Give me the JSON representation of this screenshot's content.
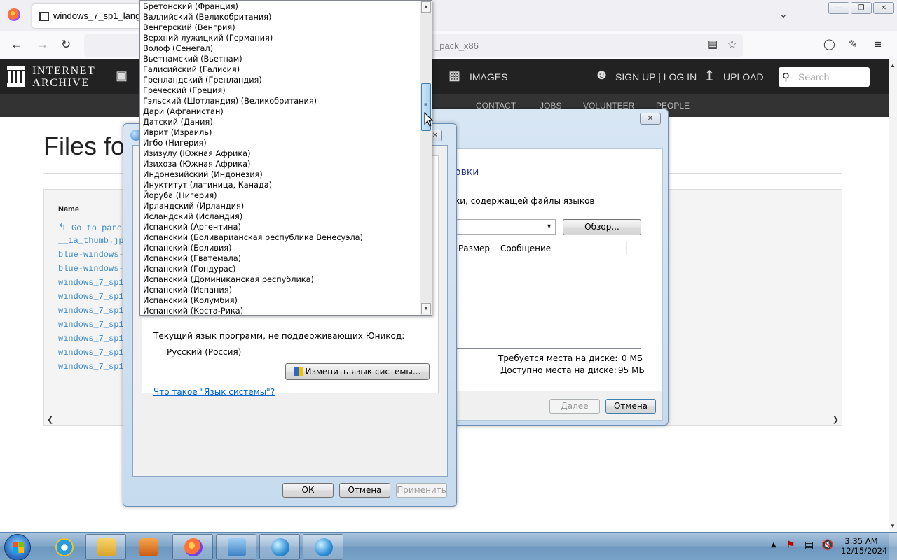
{
  "browser": {
    "tab_title": "windows_7_sp1_langua",
    "url_fragment": "_pack_x86",
    "icons": {
      "back": "back-arrow-icon",
      "forward": "forward-arrow-icon",
      "reload": "reload-icon",
      "reader": "reader-view-icon",
      "bookmark": "bookmark-star-icon",
      "pocket": "pocket-icon",
      "extensions": "extensions-icon",
      "menu": "hamburger-menu-icon"
    }
  },
  "ia": {
    "logo_line1": "INTERNET",
    "logo_line2": "ARCHIVE",
    "images": "IMAGES",
    "signup": "SIGN UP | LOG IN",
    "upload": "UPLOAD",
    "search_placeholder": "Search",
    "sub_nav": [
      "CONTACT",
      "JOBS",
      "VOLUNTEER",
      "PEOPLE"
    ],
    "page_title": "Files fo",
    "files_header": "Name",
    "files": [
      "Go to pare",
      "__ia_thumb.jp",
      "blue-windows-",
      "blue-windows-",
      "windows_7_sp1",
      "windows_7_sp1",
      "windows_7_sp1",
      "windows_7_sp1",
      "windows_7_sp1",
      "windows_7_sp1",
      "windows_7_sp1"
    ]
  },
  "install_dialog": {
    "heading_fragment": "овки",
    "instruction_fragment": "ки, содержащей файлы языков",
    "browse": "Обзор...",
    "col_size": "Размер",
    "col_message": "Сообщение",
    "space_required_label": "Требуется места на диске:",
    "space_required_value": "0 МБ",
    "space_available_label": "Доступно места на диске:",
    "space_available_value": "95 МБ",
    "next": "Далее",
    "cancel": "Отмена"
  },
  "region_dialog": {
    "nonunicode_label": "Текущий язык программ, не поддерживающих Юникод:",
    "current_language": "Русский (Россия)",
    "change_system_locale": "Изменить язык системы...",
    "help_link": "Что такое \"Язык системы\"?",
    "ok": "ОК",
    "cancel": "Отмена",
    "apply": "Применить"
  },
  "language_list": [
    "Бретонский (Франция)",
    "Валлийский (Великобритания)",
    "Венгерский (Венгрия)",
    "Верхний лужицкий (Германия)",
    "Волоф (Сенегал)",
    "Вьетнамский (Вьетнам)",
    "Галисийский (Галисия)",
    "Гренландский (Гренландия)",
    "Греческий (Греция)",
    "Гэльский (Шотландия) (Великобритания)",
    "Дари (Афганистан)",
    "Датский (Дания)",
    "Иврит (Израиль)",
    "Игбо (Нигерия)",
    "Изизулу (Южная Африка)",
    "Изихоза (Южная Африка)",
    "Индонезийский (Индонезия)",
    "Инуктитут (латиница, Канада)",
    "Йоруба (Нигерия)",
    "Ирландский (Ирландия)",
    "Исландский (Исландия)",
    "Испанский (Аргентина)",
    "Испанский (Боливарианская республика Венесуэла)",
    "Испанский (Боливия)",
    "Испанский (Гватемала)",
    "Испанский (Гондурас)",
    "Испанский (Доминиканская республика)",
    "Испанский (Испания)",
    "Испанский (Колумбия)",
    "Испанский (Коста-Рика)"
  ],
  "taskbar": {
    "time": "3:35 AM",
    "date": "12/15/2024",
    "apps": [
      "internet-explorer-icon",
      "file-explorer-icon",
      "media-player-icon",
      "firefox-icon",
      "control-panel-icon",
      "region-globe-icon",
      "language-pack-icon"
    ]
  }
}
